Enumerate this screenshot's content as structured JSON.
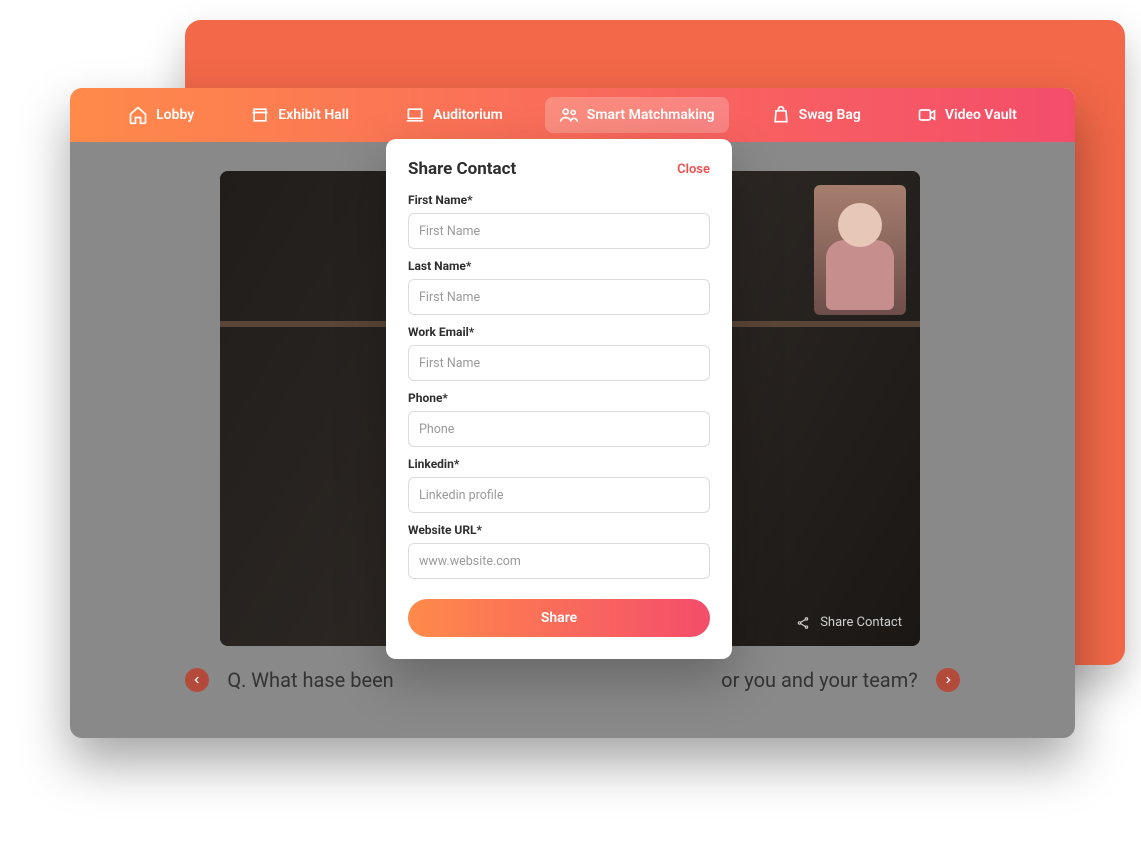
{
  "nav": {
    "items": [
      {
        "label": "Lobby"
      },
      {
        "label": "Exhibit Hall"
      },
      {
        "label": "Auditorium"
      },
      {
        "label": "Smart Matchmaking"
      },
      {
        "label": "Swag Bag"
      },
      {
        "label": "Video Vault"
      }
    ]
  },
  "video": {
    "share_label": "Share Contact"
  },
  "question": {
    "text_left": "Q. What hase been ",
    "text_right": "or you and your team?"
  },
  "modal": {
    "title": "Share Contact",
    "close": "Close",
    "fields": {
      "first_name": {
        "label": "First Name*",
        "placeholder": "First Name"
      },
      "last_name": {
        "label": "Last Name*",
        "placeholder": "First Name"
      },
      "work_email": {
        "label": "Work Email*",
        "placeholder": "First Name"
      },
      "phone": {
        "label": "Phone*",
        "placeholder": "Phone"
      },
      "linkedin": {
        "label": "Linkedin*",
        "placeholder": "Linkedin profile"
      },
      "website": {
        "label": "Website URL*",
        "placeholder": "www.website.com"
      }
    },
    "submit": "Share"
  }
}
